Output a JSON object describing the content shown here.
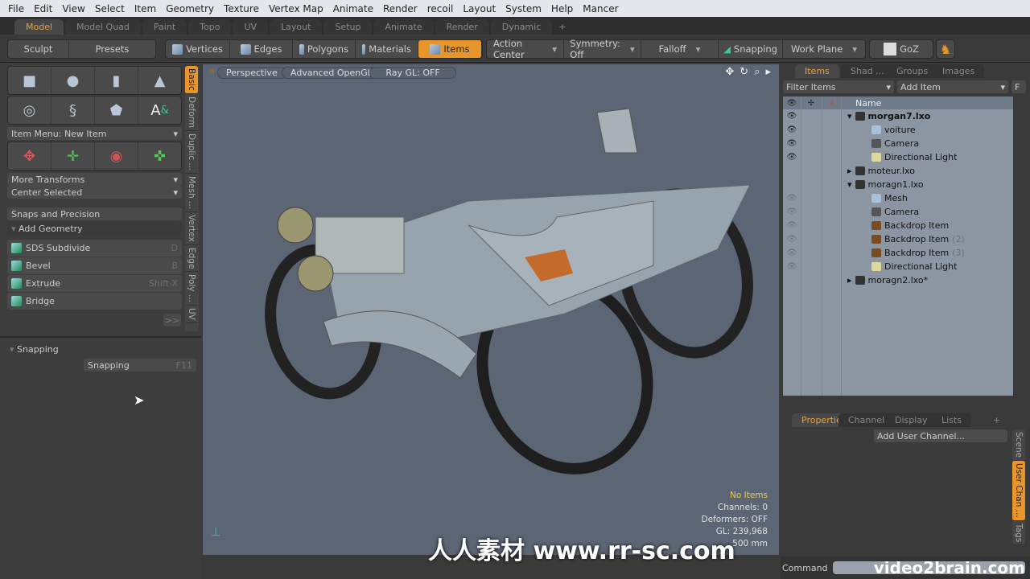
{
  "menu": [
    "File",
    "Edit",
    "View",
    "Select",
    "Item",
    "Geometry",
    "Texture",
    "Vertex Map",
    "Animate",
    "Render",
    "recoil",
    "Layout",
    "System",
    "Help",
    "Mancer"
  ],
  "mode_tabs": [
    "Model",
    "Model Quad",
    "Paint",
    "Topo",
    "UV",
    "Layout",
    "Setup",
    "Animate",
    "Render",
    "Dynamic"
  ],
  "mode_tabs_add": "+",
  "toolbar": {
    "sculpt": "Sculpt",
    "presets": "Presets",
    "vertices": "Vertices",
    "edges": "Edges",
    "polygons": "Polygons",
    "materials": "Materials",
    "items": "Items",
    "action_center": "Action Center",
    "symmetry": "Symmetry: Off",
    "falloff": "Falloff",
    "snapping": "Snapping",
    "work_plane": "Work Plane",
    "goz": "GoZ"
  },
  "left": {
    "item_menu": "Item Menu: New Item",
    "more_transforms": "More Transforms",
    "center_selected": "Center Selected",
    "snaps": "Snaps and Precision",
    "add_geometry": "Add Geometry",
    "tools": [
      {
        "label": "SDS Subdivide",
        "key": "D"
      },
      {
        "label": "Bevel",
        "key": "B"
      },
      {
        "label": "Extrude",
        "key": "Shift-X"
      },
      {
        "label": "Bridge",
        "key": ""
      }
    ],
    "more": ">>",
    "snapping_section": "Snapping",
    "snapping_btn": "Snapping",
    "snapping_key": "F11",
    "vtabs": [
      "Basic",
      "Deform",
      "Duplic ...",
      "Mesh ...",
      "Vertex",
      "Edge",
      "Poly ...",
      "UV"
    ]
  },
  "viewport": {
    "view": "Perspective",
    "shading": "Advanced OpenGL",
    "raygl": "Ray GL: OFF",
    "stats": {
      "selection": "No Items",
      "channels": "Channels: 0",
      "deformers": "Deformers: OFF",
      "gl": "GL: 239,968",
      "scale": "500 mm"
    }
  },
  "right": {
    "tabs": [
      "Items",
      "Shad ...",
      "Groups",
      "Images"
    ],
    "filter": "Filter Items",
    "add_item": "Add Item",
    "f_btn": "F",
    "name_col": "Name",
    "tree": [
      {
        "name": "morgan7.lxo",
        "type": "scene",
        "bold": true,
        "depth": 0,
        "expanded": true,
        "eye": "on"
      },
      {
        "name": "voiture",
        "type": "mesh",
        "depth": 1,
        "eye": "on"
      },
      {
        "name": "Camera",
        "type": "camera",
        "depth": 1,
        "eye": "on"
      },
      {
        "name": "Directional Light",
        "type": "light",
        "depth": 1,
        "eye": "on"
      },
      {
        "name": "moteur.lxo",
        "type": "scene",
        "depth": 0,
        "expanded": false,
        "eye": "none"
      },
      {
        "name": "moragn1.lxo",
        "type": "scene",
        "depth": 0,
        "expanded": true,
        "eye": "none"
      },
      {
        "name": "Mesh",
        "type": "mesh",
        "depth": 1,
        "eye": "dim"
      },
      {
        "name": "Camera",
        "type": "camera",
        "depth": 1,
        "eye": "dim"
      },
      {
        "name": "Backdrop Item",
        "type": "backdrop",
        "depth": 1,
        "eye": "dim"
      },
      {
        "name": "Backdrop Item",
        "suffix": "(2)",
        "type": "backdrop",
        "depth": 1,
        "eye": "dim"
      },
      {
        "name": "Backdrop Item",
        "suffix": "(3)",
        "type": "backdrop",
        "depth": 1,
        "eye": "dim"
      },
      {
        "name": "Directional Light",
        "type": "light",
        "depth": 1,
        "eye": "dim"
      },
      {
        "name": "moragn2.lxo*",
        "type": "scene",
        "depth": 0,
        "expanded": false,
        "eye": "none"
      }
    ],
    "prop_tabs": [
      "Properties",
      "Channels",
      "Display",
      "Lists"
    ],
    "prop_add": "+",
    "add_user_channel": "Add User Channel...",
    "side_tabs": [
      "Scene",
      "User Chan ...",
      "Tags"
    ],
    "command_label": "Command"
  },
  "watermark": {
    "brand": "video2brain.com",
    "site": "人人素材 www.rr-sc.com"
  },
  "colors": {
    "accent": "#e8962c",
    "viewport": "#5c6573",
    "tree_bg": "#8c96a3"
  }
}
